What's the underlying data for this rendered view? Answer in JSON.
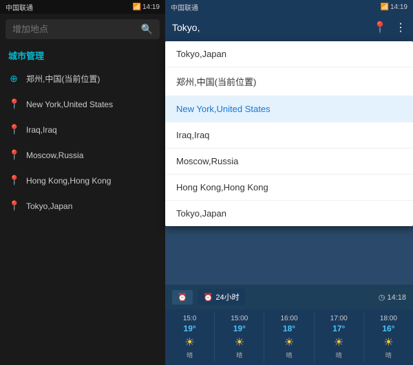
{
  "leftPanel": {
    "statusBar": {
      "carrier": "中国联通",
      "time": "14:19"
    },
    "searchPlaceholder": "增加地点",
    "sectionTitle": "城市管理",
    "cities": [
      {
        "id": "zhengzhou",
        "name": "郑州,中国(当前位置)",
        "current": true
      },
      {
        "id": "newyork",
        "name": "New York,United States",
        "current": false
      },
      {
        "id": "iraq",
        "name": "Iraq,Iraq",
        "current": false
      },
      {
        "id": "moscow",
        "name": "Moscow,Russia",
        "current": false
      },
      {
        "id": "hongkong",
        "name": "Hong Kong,Hong Kong",
        "current": false
      },
      {
        "id": "tokyo",
        "name": "Tokyo,Japan",
        "current": false
      }
    ]
  },
  "rightPanel": {
    "statusBar": {
      "carrier": "中国联通",
      "time": "14:19"
    },
    "header": {
      "cityName": "Tokyo,"
    },
    "dropdown": {
      "items": [
        {
          "id": "tokyo-top",
          "name": "Tokyo,Japan",
          "active": false
        },
        {
          "id": "zhengzhou",
          "name": "郑州,中国(当前位置)",
          "active": false
        },
        {
          "id": "newyork",
          "name": "New York,United States",
          "active": true
        },
        {
          "id": "iraq",
          "name": "Iraq,Iraq",
          "active": false
        },
        {
          "id": "moscow",
          "name": "Moscow,Russia",
          "active": false
        },
        {
          "id": "hongkong",
          "name": "Hong Kong,Hong Kong",
          "active": false
        },
        {
          "id": "tokyo-bottom",
          "name": "Tokyo,Japan",
          "active": false
        }
      ]
    },
    "timeToggle": {
      "btn1Label": "24小时",
      "timeRight": "◷ 14:18"
    },
    "hourly": [
      {
        "time": "15:0",
        "temp": "19°",
        "tempColor": "#4fc3f7",
        "desc": "晴"
      },
      {
        "time": "15:00",
        "temp": "19°",
        "tempColor": "#4fc3f7",
        "desc": "晴"
      },
      {
        "time": "16:00",
        "temp": "18°",
        "tempColor": "#4fc3f7",
        "desc": "晴"
      },
      {
        "time": "17:00",
        "temp": "17°",
        "tempColor": "#4fc3f7",
        "desc": "晴"
      },
      {
        "time": "18:00",
        "temp": "16°",
        "tempColor": "#4fc3f7",
        "desc": "晴"
      }
    ]
  }
}
